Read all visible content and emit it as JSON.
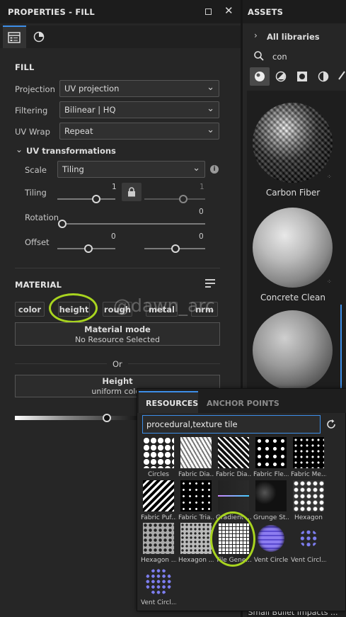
{
  "properties": {
    "title": "PROPERTIES - FILL"
  },
  "fill": {
    "heading": "FILL",
    "projection_label": "Projection",
    "projection_value": "UV projection",
    "filtering_label": "Filtering",
    "filtering_value": "Bilinear | HQ",
    "uvwrap_label": "UV Wrap",
    "uvwrap_value": "Repeat",
    "uvt_label": "UV transformations",
    "scale_label": "Scale",
    "scale_value": "Tiling",
    "tiling_label": "Tiling",
    "tiling_v1": "1",
    "tiling_v2": "1",
    "rotation_label": "Rotation",
    "rotation_v": "0",
    "offset_label": "Offset",
    "offset_v1": "0",
    "offset_v2": "0"
  },
  "material": {
    "heading": "MATERIAL",
    "chips": [
      "color",
      "height",
      "rough",
      "metal",
      "nrm"
    ],
    "mode_title": "Material mode",
    "mode_value": "No Resource Selected",
    "or": "Or",
    "height_title": "Height",
    "height_value": "uniform color"
  },
  "assets": {
    "title": "ASSETS",
    "libraries": "All libraries",
    "search": "con",
    "items": [
      "Carbon Fiber",
      "Concrete Clean",
      "Small Bullet Impacts ..."
    ]
  },
  "resources": {
    "tab1": "RESOURCES",
    "tab2": "ANCHOR POINTS",
    "search": "procedural,texture tile",
    "tiles": [
      "Circles",
      "Fabric Dia...",
      "Fabric Dia...",
      "Fabric Fle...",
      "Fabric Me...",
      "Fabric Puf...",
      "Fabric Tria...",
      "Gradient ...",
      "Grunge St...",
      "Hexagon",
      "Hexagon ...",
      "Hexagon ...",
      "Tile Gene...",
      "Vent Circle",
      "Vent Circl...",
      "Vent Circl..."
    ]
  },
  "watermark": "@dawn_arc",
  "colors": {
    "accent": "#3d8ee8",
    "highlight": "#a8d41f"
  }
}
